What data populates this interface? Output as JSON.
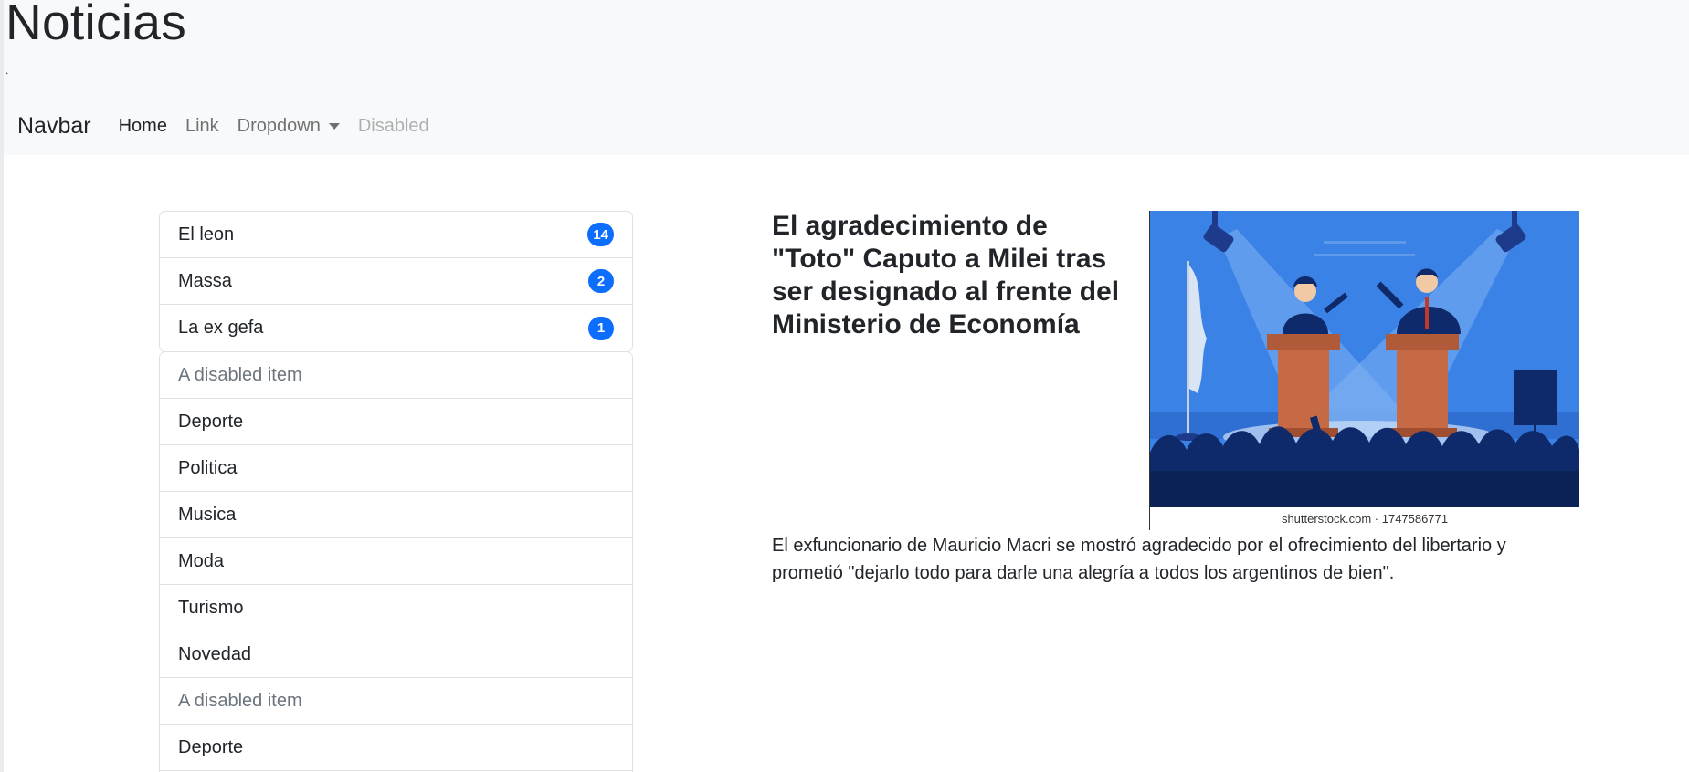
{
  "header": {
    "title": "Noticias",
    "subtext": "."
  },
  "navbar": {
    "brand": "Navbar",
    "links": [
      {
        "label": "Home",
        "state": "active"
      },
      {
        "label": "Link",
        "state": "normal"
      },
      {
        "label": "Dropdown",
        "state": "dropdown"
      },
      {
        "label": "Disabled",
        "state": "disabled"
      }
    ]
  },
  "badge_list": [
    {
      "label": "El leon",
      "count": "14"
    },
    {
      "label": "Massa",
      "count": "2"
    },
    {
      "label": "La ex gefa",
      "count": "1"
    }
  ],
  "category_list": [
    {
      "label": "A disabled item",
      "disabled": true
    },
    {
      "label": "Deporte"
    },
    {
      "label": "Politica"
    },
    {
      "label": "Musica"
    },
    {
      "label": "Moda"
    },
    {
      "label": "Turismo"
    },
    {
      "label": "Novedad"
    },
    {
      "label": "A disabled item",
      "disabled": true
    },
    {
      "label": "Deporte"
    }
  ],
  "article": {
    "title": "El agradecimiento de \"Toto\" Caputo a Milei tras ser designado al frente del Ministerio de Economía",
    "image_credit": "shutterstock.com · 1747586771",
    "body": "El exfuncionario de Mauricio Macri se mostró agradecido por el ofrecimiento del libertario y prometió \"dejarlo todo para darle una alegría a todos los argentinos de bien\"."
  },
  "colors": {
    "badge": "#0d6efd",
    "header_bg": "#f8f9fa",
    "illustration_bg": "#3b82e6"
  }
}
